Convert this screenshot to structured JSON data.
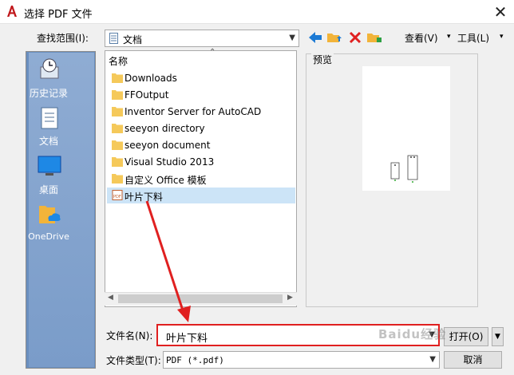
{
  "window": {
    "title": "选择 PDF 文件",
    "close_glyph": "✕"
  },
  "toolbar": {
    "look_in_label": "查找范围(I):",
    "look_in_value": "文档",
    "view_menu": "查看(V)",
    "tools_menu": "工具(L)"
  },
  "places": [
    {
      "label": "历史记录",
      "icon": "history-icon"
    },
    {
      "label": "文档",
      "icon": "documents-icon"
    },
    {
      "label": "桌面",
      "icon": "desktop-icon"
    },
    {
      "label": "OneDrive",
      "icon": "onedrive-icon"
    }
  ],
  "file_list": {
    "column_header": "名称",
    "items": [
      {
        "name": "Downloads",
        "type": "folder"
      },
      {
        "name": "FFOutput",
        "type": "folder"
      },
      {
        "name": "Inventor Server for AutoCAD",
        "type": "folder"
      },
      {
        "name": "seeyon directory",
        "type": "folder"
      },
      {
        "name": "seeyon document",
        "type": "folder"
      },
      {
        "name": "Visual Studio 2013",
        "type": "folder"
      },
      {
        "name": "自定义 Office 模板",
        "type": "folder"
      },
      {
        "name": "叶片下料",
        "type": "pdf",
        "selected": true
      }
    ]
  },
  "preview": {
    "label": "预览"
  },
  "filename": {
    "label": "文件名(N):",
    "value": "叶片下料"
  },
  "filetype": {
    "label": "文件类型(T):",
    "value": "PDF (*.pdf)"
  },
  "buttons": {
    "open": "打开(O)",
    "cancel": "取消"
  },
  "watermark": "Baidu经验",
  "colors": {
    "accent": "#e02020",
    "selection": "#cce4f7",
    "places_bg": "#7a9cc9",
    "folder": "#f5c95a"
  }
}
